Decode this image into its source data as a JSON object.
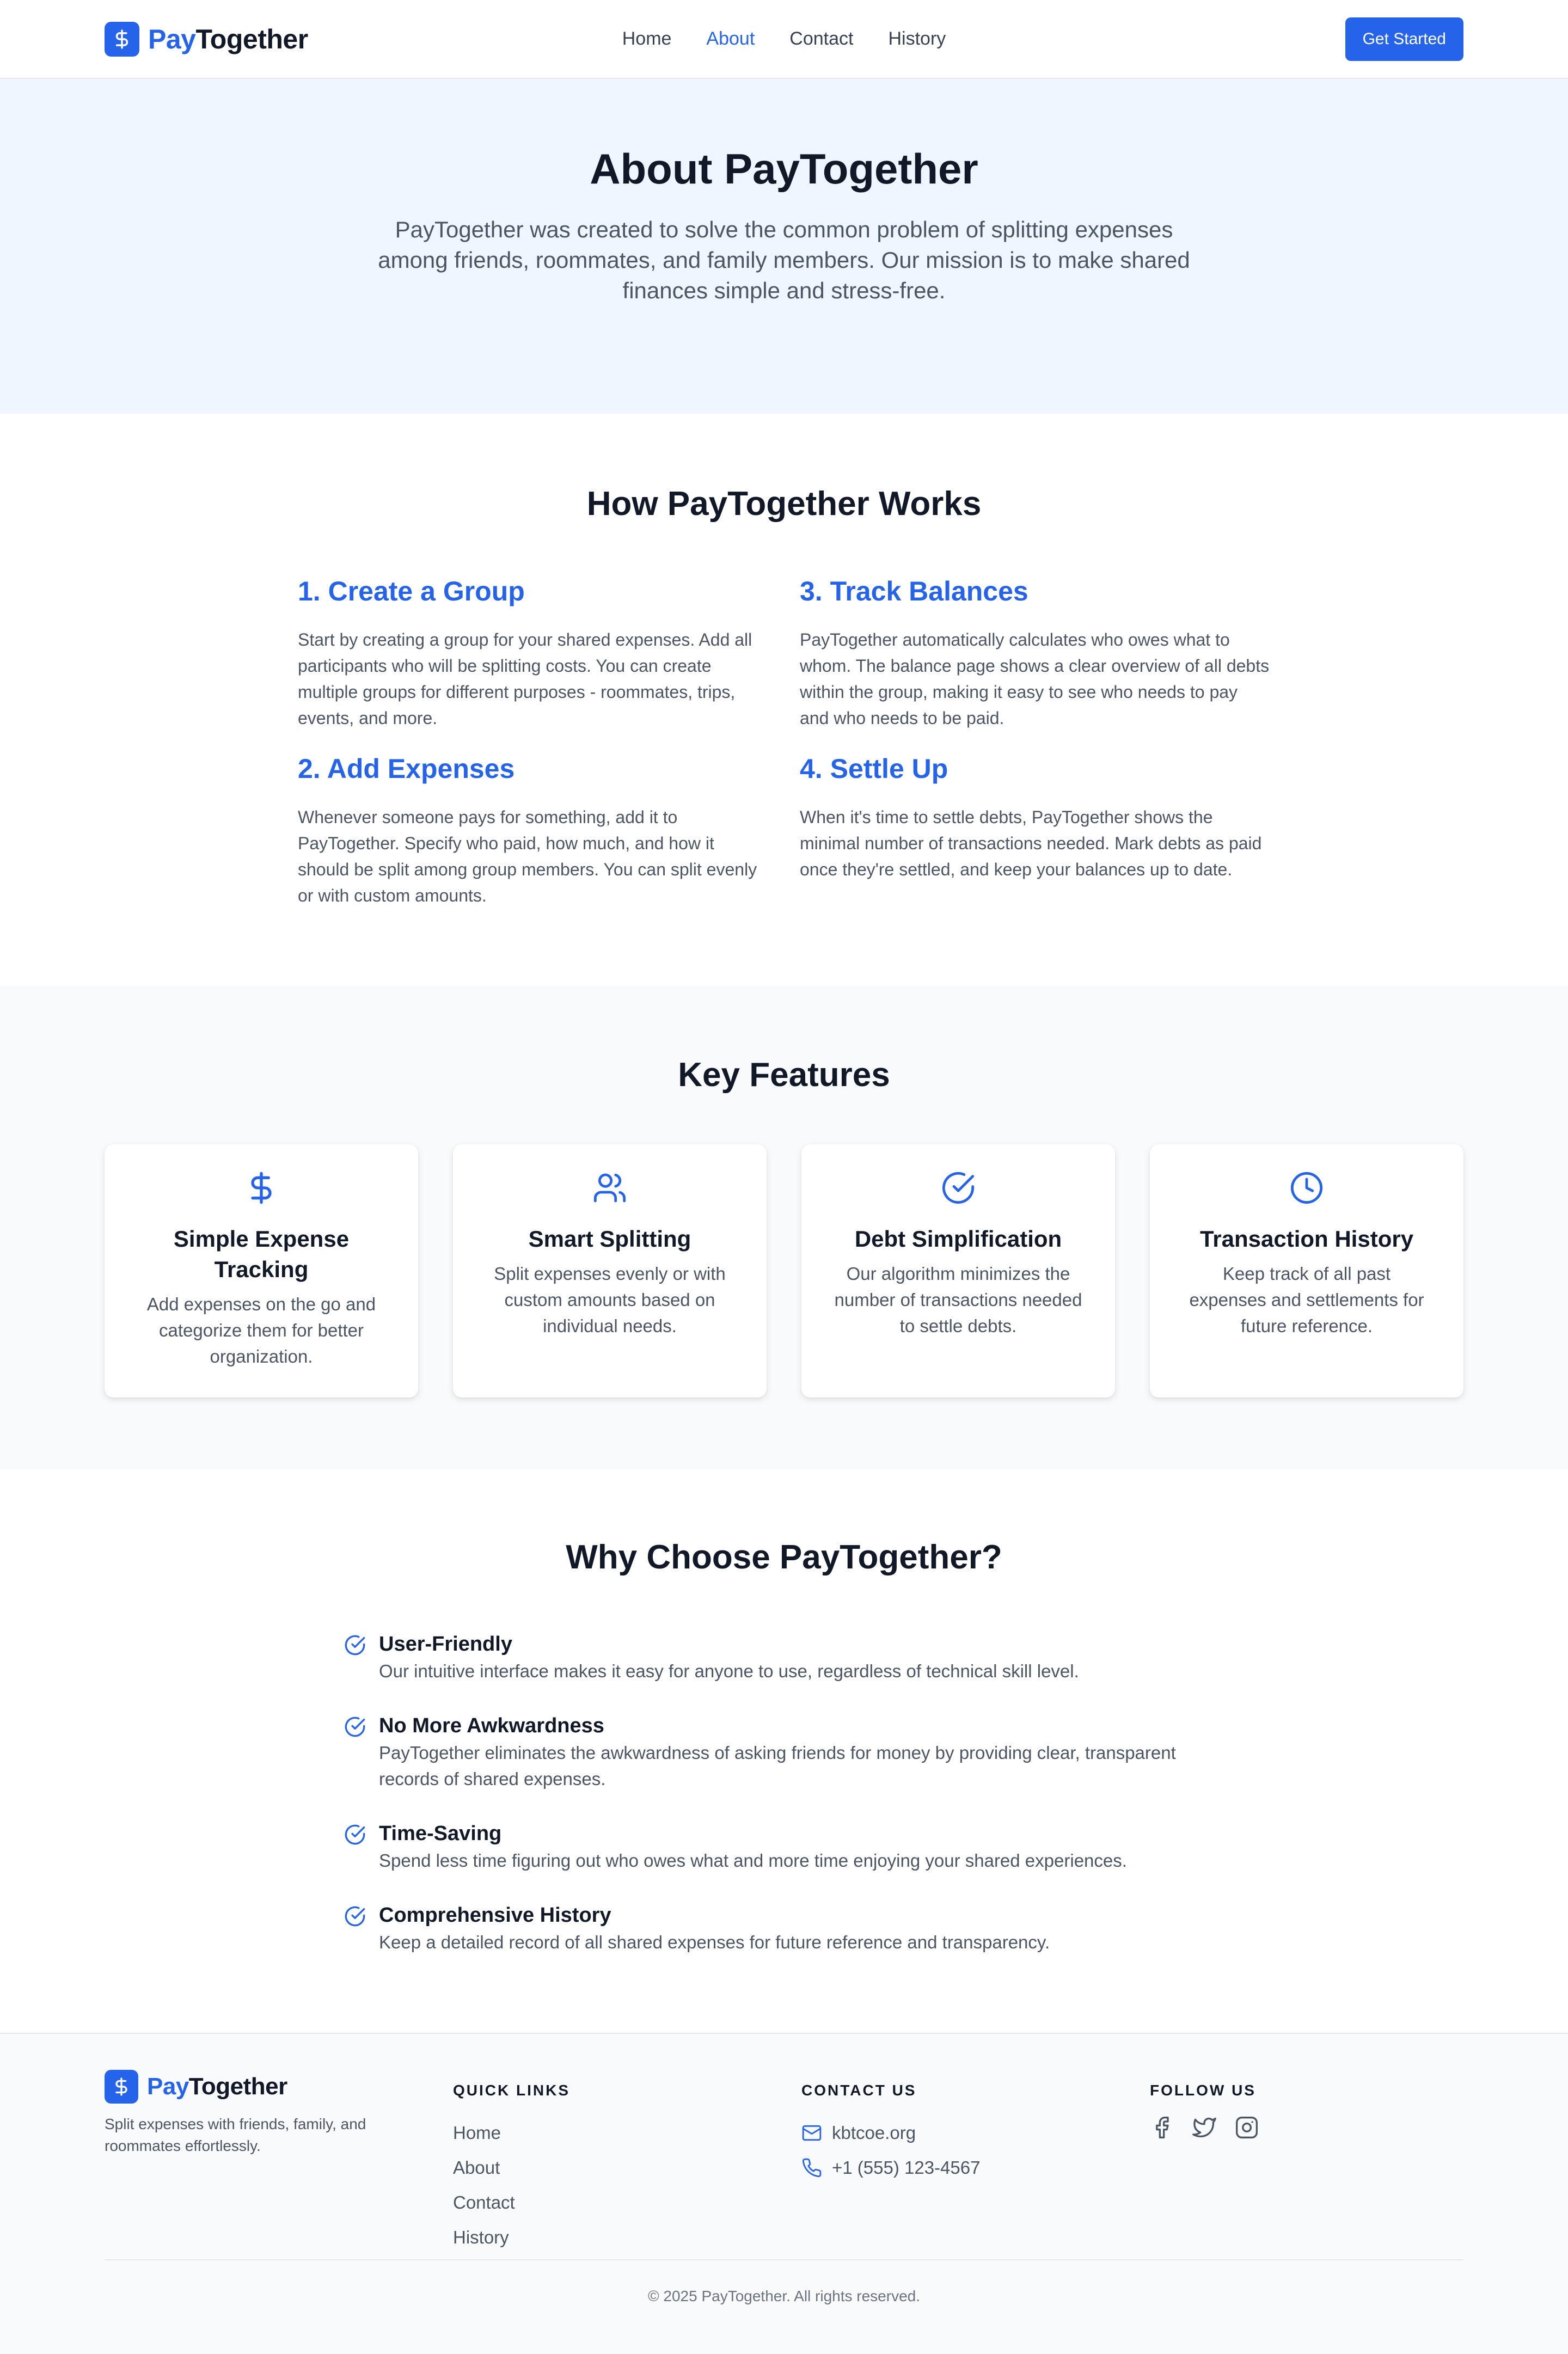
{
  "brand": {
    "name_part1": "Pay",
    "name_part2": "Together"
  },
  "nav": {
    "items": [
      {
        "label": "Home"
      },
      {
        "label": "About"
      },
      {
        "label": "Contact"
      },
      {
        "label": "History"
      }
    ],
    "active": "About",
    "cta": "Get Started"
  },
  "hero": {
    "title": "About PayTogether",
    "text": "PayTogether was created to solve the common problem of splitting expenses among friends, roommates, and family members. Our mission is to make shared finances simple and stress-free."
  },
  "how": {
    "title": "How PayTogether Works",
    "steps": [
      {
        "title": "1. Create a Group",
        "text": "Start by creating a group for your shared expenses. Add all participants who will be splitting costs. You can create multiple groups for different purposes - roommates, trips, events, and more."
      },
      {
        "title": "3. Track Balances",
        "text": "PayTogether automatically calculates who owes what to whom. The balance page shows a clear overview of all debts within the group, making it easy to see who needs to pay and who needs to be paid."
      },
      {
        "title": "2. Add Expenses",
        "text": "Whenever someone pays for something, add it to PayTogether. Specify who paid, how much, and how it should be split among group members. You can split evenly or with custom amounts."
      },
      {
        "title": "4. Settle Up",
        "text": "When it's time to settle debts, PayTogether shows the minimal number of transactions needed. Mark debts as paid once they're settled, and keep your balances up to date."
      }
    ]
  },
  "features": {
    "title": "Key Features",
    "cards": [
      {
        "icon": "dollar-icon",
        "title": "Simple Expense Tracking",
        "text": "Add expenses on the go and categorize them for better organization."
      },
      {
        "icon": "users-icon",
        "title": "Smart Splitting",
        "text": "Split expenses evenly or with custom amounts based on individual needs."
      },
      {
        "icon": "check-circle-icon",
        "title": "Debt Simplification",
        "text": "Our algorithm minimizes the number of transactions needed to settle debts."
      },
      {
        "icon": "clock-icon",
        "title": "Transaction History",
        "text": "Keep track of all past expenses and settlements for future reference."
      }
    ]
  },
  "why": {
    "title": "Why Choose PayTogether?",
    "items": [
      {
        "title": "User-Friendly",
        "text": "Our intuitive interface makes it easy for anyone to use, regardless of technical skill level."
      },
      {
        "title": "No More Awkwardness",
        "text": "PayTogether eliminates the awkwardness of asking friends for money by providing clear, transparent records of shared expenses."
      },
      {
        "title": "Time-Saving",
        "text": "Spend less time figuring out who owes what and more time enjoying your shared experiences."
      },
      {
        "title": "Comprehensive History",
        "text": "Keep a detailed record of all shared expenses for future reference and transparency."
      }
    ]
  },
  "footer": {
    "tagline": "Split expenses with friends, family, and roommates effortlessly.",
    "quick_links_heading": "QUICK LINKS",
    "quick_links": [
      "Home",
      "About",
      "Contact",
      "History"
    ],
    "contact_heading": "CONTACT US",
    "email": "kbtcoe.org",
    "phone": "+1 (555) 123-4567",
    "follow_heading": "FOLLOW US",
    "social": [
      "facebook-icon",
      "twitter-icon",
      "instagram-icon"
    ],
    "copyright": "© 2025 PayTogether. All rights reserved."
  },
  "colors": {
    "accent": "#2563eb",
    "hero_bg": "#eff6ff",
    "section_bg": "#f9fafb",
    "text_dark": "#111827",
    "text_muted": "#4b5563"
  }
}
